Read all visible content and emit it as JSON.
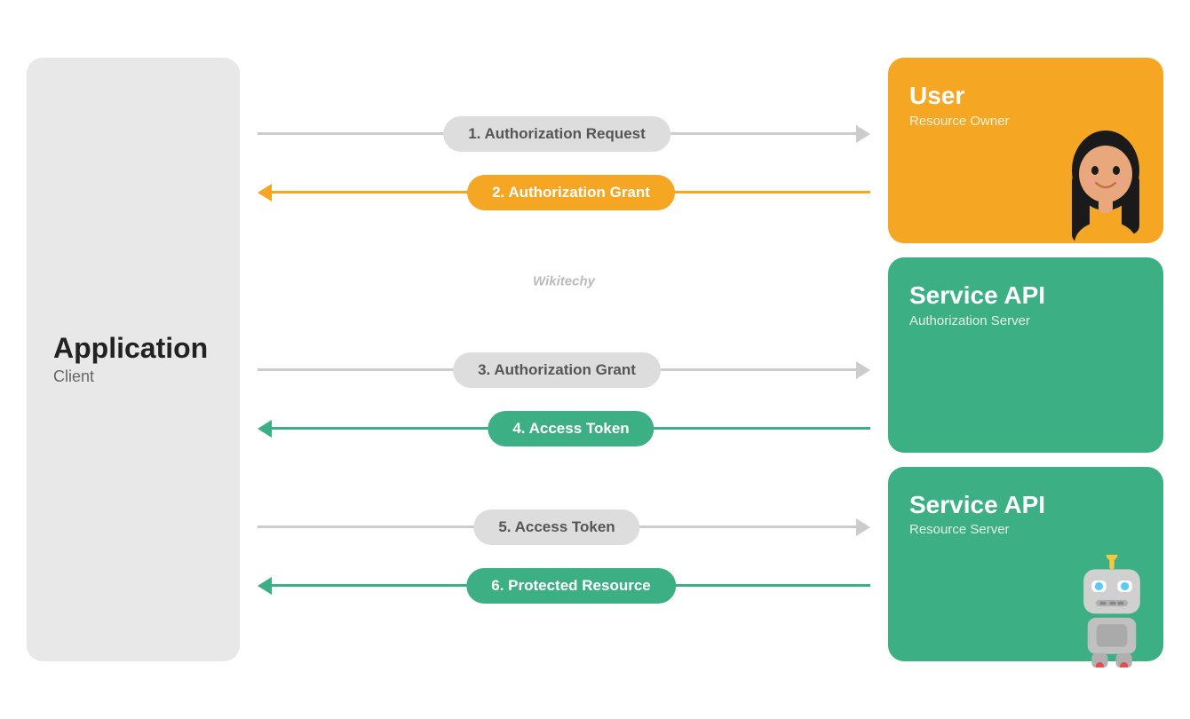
{
  "client": {
    "title": "Application",
    "subtitle": "Client"
  },
  "flows": {
    "group1": [
      {
        "label": "1. Authorization Request",
        "direction": "right",
        "style": "gray"
      },
      {
        "label": "2. Authorization Grant",
        "direction": "left",
        "style": "orange"
      }
    ],
    "group2": [
      {
        "label": "3. Authorization Grant",
        "direction": "right",
        "style": "gray"
      },
      {
        "label": "4. Access Token",
        "direction": "left",
        "style": "green"
      }
    ],
    "group3": [
      {
        "label": "5. Access Token",
        "direction": "right",
        "style": "gray"
      },
      {
        "label": "6. Protected Resource",
        "direction": "left",
        "style": "green"
      }
    ]
  },
  "panels": {
    "user": {
      "title": "User",
      "subtitle": "Resource Owner"
    },
    "authServer": {
      "title": "Service API",
      "subtitle": "Authorization Server"
    },
    "resourceServer": {
      "title": "Service API",
      "subtitle": "Resource Server"
    }
  },
  "watermark": "Wikitech y"
}
